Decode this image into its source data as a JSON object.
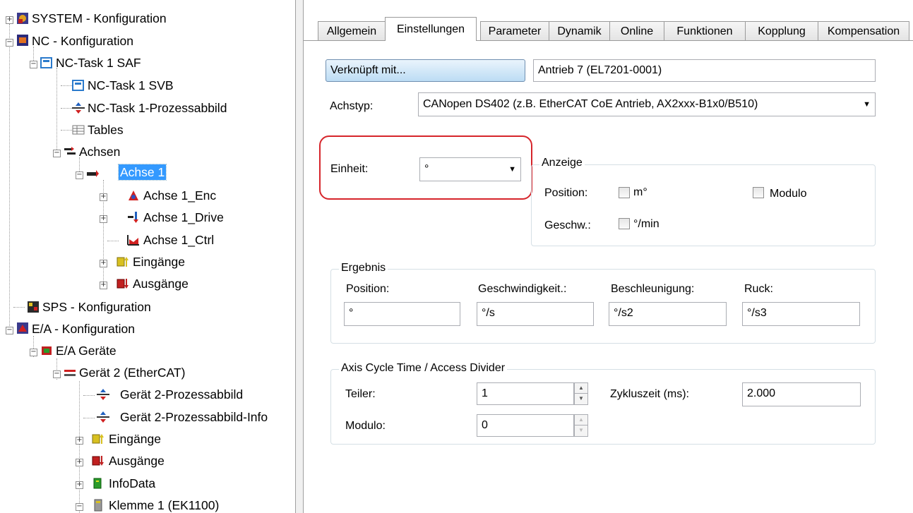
{
  "tree": {
    "items": [
      {
        "label": "SYSTEM - Konfiguration",
        "expander": "+"
      },
      {
        "label": "NC - Konfiguration",
        "expander": "−"
      },
      {
        "label": "NC-Task 1 SAF",
        "expander": "−"
      },
      {
        "label": "NC-Task 1 SVB",
        "expander": ""
      },
      {
        "label": "NC-Task 1-Prozessabbild",
        "expander": ""
      },
      {
        "label": "Tables",
        "expander": ""
      },
      {
        "label": "Achsen",
        "expander": "−"
      },
      {
        "label": "Achse 1",
        "expander": "−"
      },
      {
        "label": "Achse 1_Enc",
        "expander": "+"
      },
      {
        "label": "Achse 1_Drive",
        "expander": "+"
      },
      {
        "label": "Achse 1_Ctrl",
        "expander": ""
      },
      {
        "label": "Eingänge",
        "expander": "+"
      },
      {
        "label": "Ausgänge",
        "expander": "+"
      },
      {
        "label": "SPS - Konfiguration",
        "expander": ""
      },
      {
        "label": "E/A - Konfiguration",
        "expander": "−"
      },
      {
        "label": "E/A Geräte",
        "expander": "−"
      },
      {
        "label": "Gerät 2 (EtherCAT)",
        "expander": "−"
      },
      {
        "label": "Gerät 2-Prozessabbild",
        "expander": ""
      },
      {
        "label": "Gerät 2-Prozessabbild-Info",
        "expander": ""
      },
      {
        "label": "Eingänge",
        "expander": "+"
      },
      {
        "label": "Ausgänge",
        "expander": "+"
      },
      {
        "label": "InfoData",
        "expander": "+"
      },
      {
        "label": "Klemme 1 (EK1100)",
        "expander": "−"
      }
    ]
  },
  "tabs": [
    "Allgemein",
    "Einstellungen",
    "Parameter",
    "Dynamik",
    "Online",
    "Funktionen",
    "Kopplung",
    "Kompensation"
  ],
  "settings": {
    "link_button": "Verknüpft mit...",
    "link_value": "Antrieb 7 (EL7201-0001)",
    "axis_type_label": "Achstyp:",
    "axis_type_value": "CANopen DS402  (z.B. EtherCAT CoE Antrieb, AX2xxx-B1x0/B510)",
    "unit_label": "Einheit:",
    "unit_value": "°",
    "display": {
      "title": "Anzeige",
      "position_label": "Position:",
      "position_check": "m°",
      "modulo_check": "Modulo",
      "speed_label": "Geschw.:",
      "speed_check": "°/min"
    },
    "result": {
      "title": "Ergebnis",
      "position_label": "Position:",
      "position_value": "°",
      "speed_label": "Geschwindigkeit.:",
      "speed_value": "°/s",
      "accel_label": "Beschleunigung:",
      "accel_value": "°/s2",
      "jerk_label": "Ruck:",
      "jerk_value": "°/s3"
    },
    "cycle": {
      "title": "Axis Cycle Time / Access Divider",
      "divider_label": "Teiler:",
      "divider_value": "1",
      "cycle_label": "Zykluszeit (ms):",
      "cycle_value": "2.000",
      "modulo_label": "Modulo:",
      "modulo_value": "0"
    }
  },
  "colors": {
    "selection": "#3399ff",
    "highlight_ring": "#d6252b"
  }
}
